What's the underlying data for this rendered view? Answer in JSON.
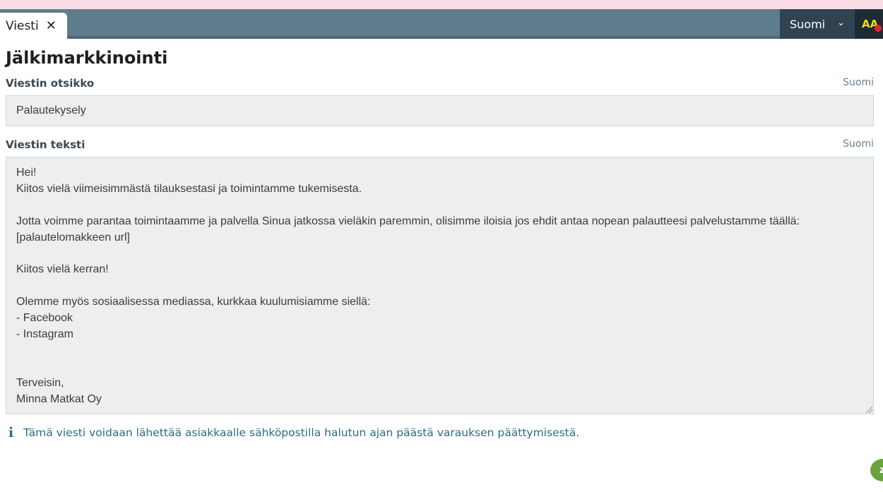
{
  "tab": {
    "label": "Viesti",
    "close_symbol": "✕"
  },
  "header": {
    "language": "Suomi",
    "chevron": "⌄",
    "accessibility_label": "AA"
  },
  "page": {
    "title": "Jälkimarkkinointi"
  },
  "subject": {
    "label": "Viestin otsikko",
    "language": "Suomi",
    "value": "Palautekysely"
  },
  "body": {
    "label": "Viestin teksti",
    "language": "Suomi",
    "value": "Hei!\nKiitos vielä viimeisimmästä tilauksestasi ja toimintamme tukemisesta.\n\nJotta voimme parantaa toimintaamme ja palvella Sinua jatkossa vieläkin paremmin, olisimme iloisia jos ehdit antaa nopean palautteesi palvelustamme täällä:\n[palautelomakkeen url]\n\nKiitos vielä kerran!\n\nOlemme myös sosiaalisessa mediassa, kurkkaa kuulumisiamme siellä:\n- Facebook\n- Instagram\n\n\nTerveisin,\nMinna Matkat Oy"
  },
  "info": {
    "icon": "i",
    "text": "Tämä viesti voidaan lähettää asiakkaalle sähköpostilla halutun ajan päästä varauksen päättymisestä."
  },
  "chat": {
    "label": "z"
  },
  "colors": {
    "tabbar": "#5f7d8c",
    "language_select": "#2f4350",
    "accessibility_button": "#1f2b33",
    "info_text": "#2e6b88",
    "chat_bubble": "#6aa33a"
  }
}
